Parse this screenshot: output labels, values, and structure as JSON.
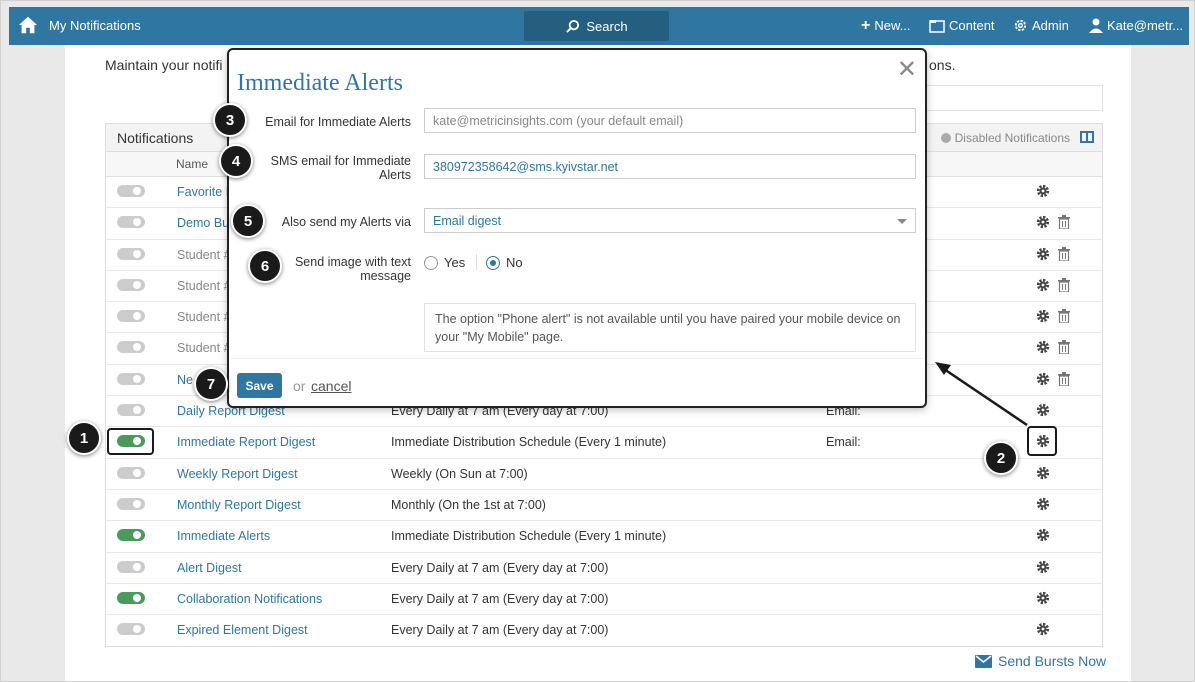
{
  "header": {
    "title": "My Notifications",
    "search_label": "Search",
    "nav": {
      "new_label": "New...",
      "content_label": "Content",
      "admin_label": "Admin",
      "user_label": "Kate@metr..."
    }
  },
  "page": {
    "intro_text": "Maintain your notifi",
    "intro_tail": "ons.",
    "table_title": "Notifications",
    "disabled_label": "Disabled Notifications",
    "column_name": "Name",
    "rows": [
      {
        "name": "Favorite I",
        "schedule": "",
        "email": "",
        "on": false,
        "trash": false,
        "muted": false
      },
      {
        "name": "Demo Bu",
        "schedule": "",
        "email": "",
        "on": false,
        "trash": true,
        "muted": false
      },
      {
        "name": "Student #",
        "schedule": "",
        "email": "",
        "on": false,
        "trash": true,
        "muted": true
      },
      {
        "name": "Student #",
        "schedule": "",
        "email": "",
        "on": false,
        "trash": true,
        "muted": true
      },
      {
        "name": "Student #",
        "schedule": "",
        "email": "",
        "on": false,
        "trash": true,
        "muted": true
      },
      {
        "name": "Student #",
        "schedule": "",
        "email": "",
        "on": false,
        "trash": true,
        "muted": true
      },
      {
        "name": "Ne",
        "schedule": "",
        "email": "",
        "on": false,
        "trash": true,
        "muted": false
      },
      {
        "name": "Daily Report Digest",
        "schedule": "Every Daily at 7 am (Every day at 7:00)",
        "email": "Email:",
        "on": false,
        "trash": false,
        "muted": false
      },
      {
        "name": "Immediate Report Digest",
        "schedule": "Immediate Distribution Schedule (Every 1 minute)",
        "email": "Email:",
        "on": true,
        "trash": false,
        "muted": false
      },
      {
        "name": "Weekly Report Digest",
        "schedule": "Weekly (On Sun at 7:00)",
        "email": "",
        "on": false,
        "trash": false,
        "muted": false
      },
      {
        "name": "Monthly Report Digest",
        "schedule": "Monthly (On the 1st at 7:00)",
        "email": "",
        "on": false,
        "trash": false,
        "muted": false
      },
      {
        "name": "Immediate Alerts",
        "schedule": "Immediate Distribution Schedule (Every 1 minute)",
        "email": "",
        "on": true,
        "trash": false,
        "muted": false
      },
      {
        "name": "Alert Digest",
        "schedule": "Every Daily at 7 am (Every day at 7:00)",
        "email": "",
        "on": false,
        "trash": false,
        "muted": false
      },
      {
        "name": "Collaboration Notifications",
        "schedule": "Every Daily at 7 am (Every day at 7:00)",
        "email": "",
        "on": true,
        "trash": false,
        "muted": false
      },
      {
        "name": "Expired Element Digest",
        "schedule": "Every Daily at 7 am (Every day at 7:00)",
        "email": "",
        "on": false,
        "trash": false,
        "muted": false
      }
    ],
    "send_bursts_label": "Send Bursts Now"
  },
  "modal": {
    "title": "Immediate Alerts",
    "email_label": "Email for Immediate Alerts",
    "email_placeholder": "kate@metricinsights.com (your default email)",
    "sms_label": "SMS email for Immediate Alerts",
    "sms_value": "380972358642@sms.kyivstar.net",
    "also_send_label": "Also send my Alerts via",
    "also_send_value": "Email digest",
    "image_label": "Send image with text message",
    "radio_yes": "Yes",
    "radio_no": "No",
    "radio_selected": "No",
    "note": "The option \"Phone alert\" is not available until you have paired your mobile device on your \"My Mobile\" page.",
    "save_label": "Save",
    "or_label": "or",
    "cancel_label": "cancel"
  },
  "callouts": [
    "1",
    "2",
    "3",
    "4",
    "5",
    "6",
    "7"
  ],
  "colors": {
    "brand": "#2f77a0",
    "toggle_on": "#4a9a5c",
    "toggle_off": "#cccccc",
    "callout": "#1a1a1a"
  }
}
